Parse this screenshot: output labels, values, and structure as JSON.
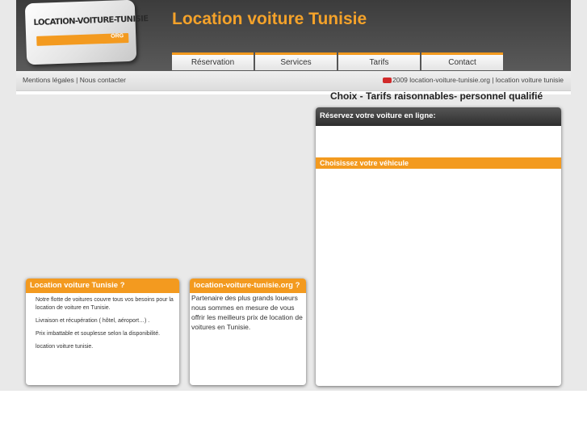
{
  "header": {
    "site_title": "Location voiture Tunisie",
    "logo_text": "LOCATION-VOITURE-TUNISIE",
    "logo_suffix": "ORG"
  },
  "nav": {
    "items": [
      {
        "label": "Réservation"
      },
      {
        "label": "Services"
      },
      {
        "label": "Tarifs"
      },
      {
        "label": "Contact"
      }
    ]
  },
  "subbar": {
    "legal_link": "Mentions légales",
    "separator": " | ",
    "contact_link": "Nous contacter",
    "copyright": "2009 location-voiture-tunisie.org | location voiture tunisie"
  },
  "slogan": "Choix - Tarifs raisonnables- personnel qualifié",
  "reservation": {
    "title": "Réservez votre voiture en ligne:",
    "choose_vehicle": "Choisissez votre véhicule"
  },
  "info_box": {
    "title": "Location voiture Tunisie ?",
    "lines": [
      "Notre flotte de voitures couvre tous vos besoins pour la location de voiture en Tunisie.",
      "Livraison et récupération ( hôtel, aéroport…) .",
      "Prix imbattable et souplesse selon la disponibilité.",
      "location voiture tunisie."
    ]
  },
  "partner_box": {
    "title": "location-voiture-tunisie.org ?",
    "text": "Partenaire des plus grands loueurs nous sommes en mesure de vous offrir les meilleurs prix de location de voitures en Tunisie."
  },
  "colors": {
    "accent_orange": "#f39a1f",
    "header_dark": "#3c3c3c",
    "title_orange": "#f4a22a"
  }
}
